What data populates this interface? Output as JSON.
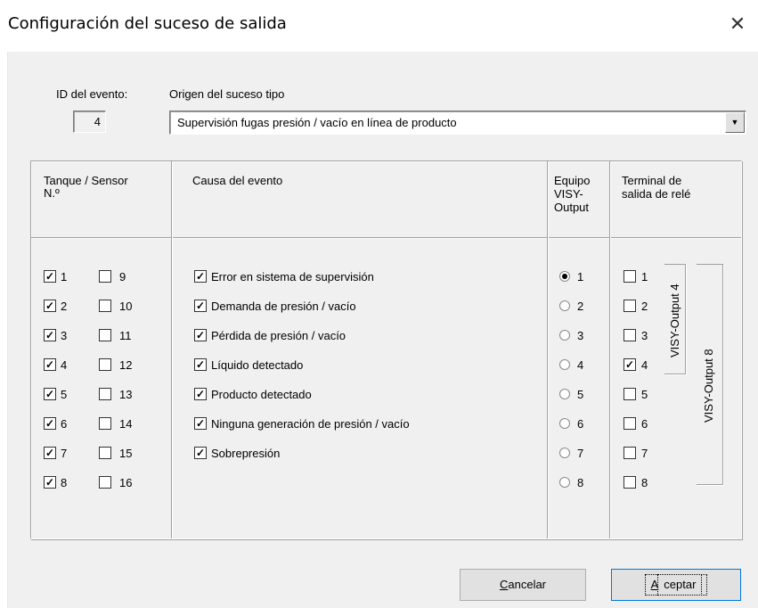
{
  "window": {
    "title": "Configuración del suceso de salida",
    "close_glyph": "✕"
  },
  "id_label": "ID del evento:",
  "id_value": "4",
  "origin_label": "Origen del suceso tipo",
  "origin_value": "Supervisión fugas presión / vacío en línea de producto",
  "headers": {
    "tank": "Tanque / Sensor",
    "tank2": "N.º",
    "cause": "Causa del evento",
    "equipo1": "Equipo",
    "equipo2": "VISY-",
    "equipo3": "Output",
    "terminal1": "Terminal de",
    "terminal2": "salida de relé"
  },
  "sensors_left": [
    {
      "label": "1",
      "checked": true
    },
    {
      "label": "2",
      "checked": true
    },
    {
      "label": "3",
      "checked": true
    },
    {
      "label": "4",
      "checked": true
    },
    {
      "label": "5",
      "checked": true
    },
    {
      "label": "6",
      "checked": true
    },
    {
      "label": "7",
      "checked": true
    },
    {
      "label": "8",
      "checked": true
    }
  ],
  "sensors_right": [
    {
      "label": "9",
      "checked": false
    },
    {
      "label": "10",
      "checked": false
    },
    {
      "label": "11",
      "checked": false
    },
    {
      "label": "12",
      "checked": false
    },
    {
      "label": "13",
      "checked": false
    },
    {
      "label": "14",
      "checked": false
    },
    {
      "label": "15",
      "checked": false
    },
    {
      "label": "16",
      "checked": false
    }
  ],
  "causes": [
    {
      "label": "Error en sistema de supervisión",
      "checked": true
    },
    {
      "label": "Demanda de presión / vacío",
      "checked": true
    },
    {
      "label": "Pérdida de presión / vacío",
      "checked": true
    },
    {
      "label": "Líquido detectado",
      "checked": true
    },
    {
      "label": "Producto detectado",
      "checked": true
    },
    {
      "label": "Ninguna generación de presión / vacío",
      "checked": true
    },
    {
      "label": "Sobrepresión",
      "checked": true
    }
  ],
  "equipos": [
    {
      "label": "1",
      "selected": true
    },
    {
      "label": "2",
      "selected": false
    },
    {
      "label": "3",
      "selected": false
    },
    {
      "label": "4",
      "selected": false
    },
    {
      "label": "5",
      "selected": false
    },
    {
      "label": "6",
      "selected": false
    },
    {
      "label": "7",
      "selected": false
    },
    {
      "label": "8",
      "selected": false
    }
  ],
  "terminals": [
    {
      "label": "1",
      "checked": false
    },
    {
      "label": "2",
      "checked": false
    },
    {
      "label": "3",
      "checked": false
    },
    {
      "label": "4",
      "checked": true
    },
    {
      "label": "5",
      "checked": false
    },
    {
      "label": "6",
      "checked": false
    },
    {
      "label": "7",
      "checked": false
    },
    {
      "label": "8",
      "checked": false
    }
  ],
  "group_labels": {
    "output4": "VISY-Output 4",
    "output8": "VISY-Output 8"
  },
  "buttons": {
    "cancel_first": "C",
    "cancel_rest": "ancelar",
    "accept_first": "A",
    "accept_rest": "ceptar"
  }
}
